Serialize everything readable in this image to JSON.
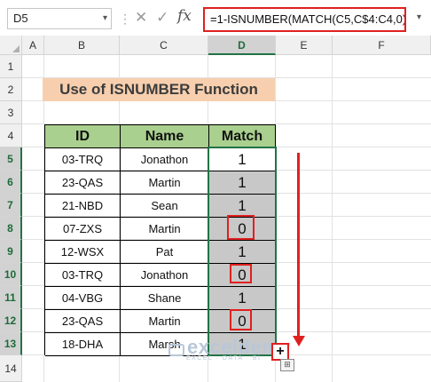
{
  "formula_bar": {
    "name_box": "D5",
    "name_box_arrow": "▾",
    "cancel_icon": "✕",
    "enter_icon": "✓",
    "fx_label": "fx",
    "formula": "=1-ISNUMBER(MATCH(C5,C$4:C4,0))",
    "expand_icon": "▾"
  },
  "columns": [
    "A",
    "B",
    "C",
    "D",
    "E",
    "F"
  ],
  "selected_column": "D",
  "rows": [
    "1",
    "2",
    "3",
    "4",
    "5",
    "6",
    "7",
    "8",
    "9",
    "10",
    "11",
    "12",
    "13",
    "14"
  ],
  "selected_row_range": [
    "5",
    "13"
  ],
  "title": "Use of ISNUMBER Function",
  "table": {
    "headers": [
      "ID",
      "Name",
      "Match"
    ],
    "rows": [
      [
        "03-TRQ",
        "Jonathon",
        "1"
      ],
      [
        "23-QAS",
        "Martin",
        "1"
      ],
      [
        "21-NBD",
        "Sean",
        "1"
      ],
      [
        "07-ZXS",
        "Martin",
        "0"
      ],
      [
        "12-WSX",
        "Pat",
        "1"
      ],
      [
        "03-TRQ",
        "Jonathon",
        "0"
      ],
      [
        "04-VBG",
        "Shane",
        "1"
      ],
      [
        "23-QAS",
        "Martin",
        "0"
      ],
      [
        "18-DHA",
        "Marsh",
        "1"
      ]
    ]
  },
  "highlighted_match_values": [
    3,
    5,
    7
  ],
  "watermark": {
    "name": "exceldemy",
    "tagline": "EXCEL · DATA · BI"
  },
  "fill_cursor": "+",
  "quick_analysis": "⊞",
  "colors": {
    "accent_green": "#217346",
    "header_fill": "#a9d08e",
    "title_fill": "#f7cfae",
    "annotation_red": "#e02020",
    "filled_cell": "#c8c8c8"
  }
}
